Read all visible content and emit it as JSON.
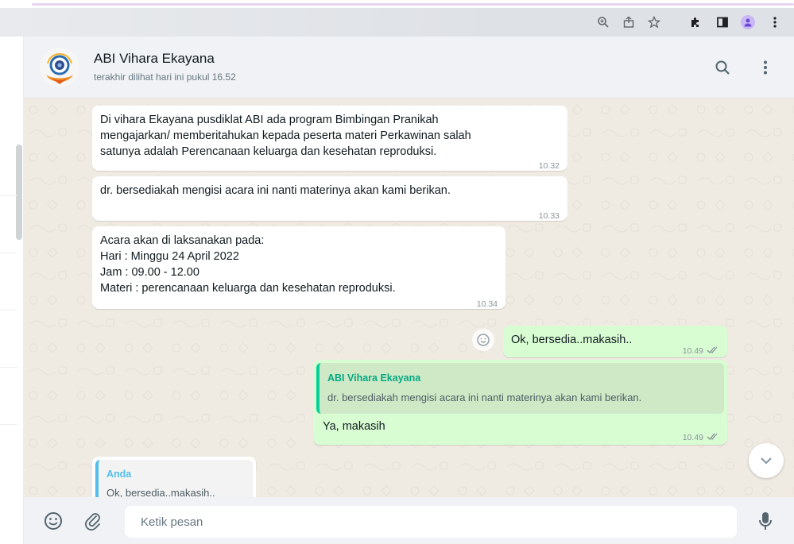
{
  "chat": {
    "contact_name": "ABI Vihara Ekayana",
    "last_seen": "terakhir dilihat hari ini pukul 16.52"
  },
  "messages": [
    {
      "direction": "in",
      "lines": [
        "Di vihara Ekayana pusdiklat ABI ada program Bimbingan Pranikah",
        "mengajarkan/ memberitahukan kepada peserta materi Perkawinan salah",
        "satunya adalah Perencanaan keluarga dan kesehatan reproduksi."
      ],
      "time": "10.32"
    },
    {
      "direction": "in",
      "lines": [
        "dr. bersediakah mengisi acara ini nanti materinya akan kami berikan."
      ],
      "time": "10.33"
    },
    {
      "direction": "in",
      "lines": [
        "Acara akan di laksanakan pada:",
        "Hari : Minggu 24 April 2022",
        "Jam : 09.00 - 12.00",
        "Materi : perencanaan keluarga dan kesehatan reproduksi."
      ],
      "time": "10.34"
    },
    {
      "direction": "out",
      "lines": [
        "Ok, bersedia..makasih.."
      ],
      "time": "10.49"
    },
    {
      "direction": "out",
      "quote": {
        "author": "ABI Vihara Ekayana",
        "text": "dr. bersediakah mengisi acara ini nanti materinya akan kami berikan."
      },
      "lines": [
        "Ya, makasih"
      ],
      "time": "10.49"
    },
    {
      "direction": "in",
      "quote": {
        "author": "Anda",
        "text": "Ok, bersedia..makasih.."
      },
      "lines": [],
      "time": ""
    }
  ],
  "composer": {
    "placeholder": "Ketik pesan"
  },
  "icons": {
    "browser": [
      "zoom-icon",
      "share-icon",
      "star-icon",
      "extensions-icon",
      "sidepanel-icon",
      "profile-icon",
      "menu-dots-icon"
    ],
    "header": [
      "search-icon",
      "more-options-icon"
    ],
    "composer": [
      "emoji-icon",
      "attach-icon",
      "microphone-icon"
    ],
    "chat": [
      "reaction-icon",
      "scroll-down-chevron-icon",
      "double-check-icon"
    ]
  },
  "colors": {
    "incoming_bubble": "#ffffff",
    "outgoing_bubble": "#d9fdd3",
    "chat_background": "#efeae2",
    "header_background": "#f0f2f5",
    "quote_bar_outgoing": "#06cf9c",
    "quote_bar_incoming": "#53bdeb"
  }
}
